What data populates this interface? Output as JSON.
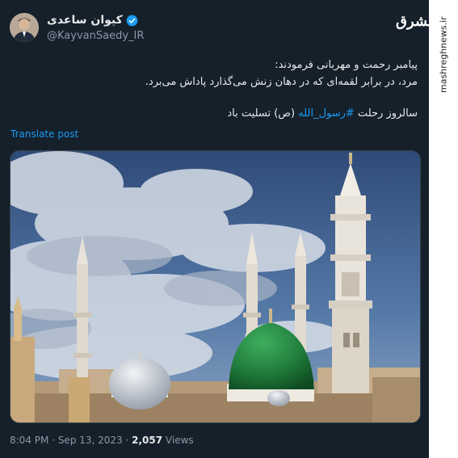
{
  "author": {
    "display_name": "کیوان ساعدی",
    "handle": "@KayvanSaedy_IR"
  },
  "tweet": {
    "line1": "پیامبر رحمت و مهربانی فرمودند:",
    "line2": "مرد، در برابر لقمه‌ای که در دهان زنش می‌گذارد پاداش می‌برد.",
    "line3_before": "سالروز رحلت ",
    "hashtag": "#رسول_الله",
    "line3_after": " (ص) تسلیت باد",
    "translate_label": "Translate post"
  },
  "meta": {
    "time": "8:04 PM",
    "separator": " · ",
    "date": "Sep 13, 2023",
    "views_count": "2,057",
    "views_label": " Views"
  },
  "watermark": {
    "site": "mashreghnews.ir",
    "logo_text": "مشرق"
  },
  "colors": {
    "background": "#15202b",
    "link": "#1d9bf0",
    "verified": "#1d9bf0",
    "secondary_text": "#8b98a5",
    "dome_green": "#1f7a3a"
  }
}
